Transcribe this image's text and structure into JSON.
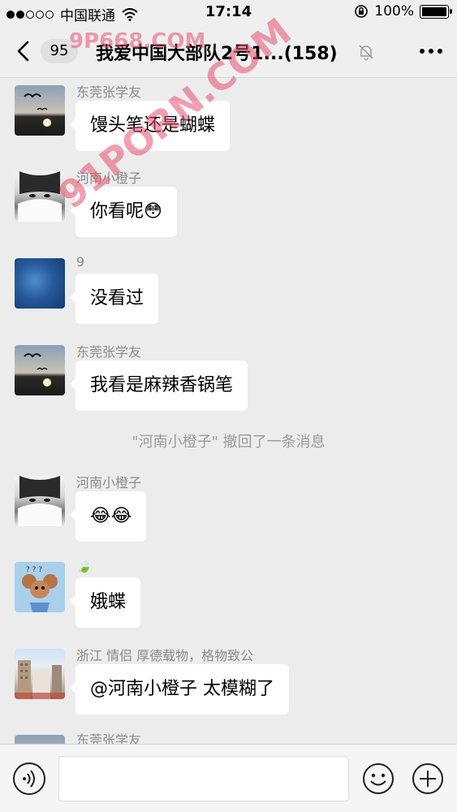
{
  "status_bar": {
    "carrier": "中国联通",
    "time": "17:14",
    "battery": "100%"
  },
  "header": {
    "unread_count": "95",
    "title": "我爱中国大部队2号1...(158)"
  },
  "messages": [
    {
      "sender": "东莞张学友",
      "text": "馒头笔还是蝴蝶",
      "avatar": "seagull-sunset"
    },
    {
      "sender": "河南小橙子",
      "text": "你看呢😳",
      "avatar": "girl-covered-face"
    },
    {
      "sender": "9",
      "text": "没看过",
      "avatar": "blue-water"
    },
    {
      "sender": "东莞张学友",
      "text": "我看是麻辣香锅笔",
      "avatar": "seagull-sunset"
    },
    {
      "sender": "河南小橙子",
      "text": "😂😂",
      "avatar": "girl-covered-face"
    },
    {
      "sender": "🍃",
      "text": "娥蝶",
      "avatar": "cartoon-mouse"
    },
    {
      "sender": "浙江  情侣  厚德载物，格物致公",
      "text": "@河南小橙子 太模糊了",
      "avatar": "city-building"
    },
    {
      "sender": "东莞张学友",
      "avatar": "seagull-sunset"
    }
  ],
  "system_notice": "\"河南小橙子\" 撤回了一条消息",
  "input_bar": {
    "voice_icon": "voice-icon",
    "emoji_icon": "emoji-icon",
    "plus_icon": "plus-icon"
  },
  "watermarks": [
    "9P668.COM",
    "91PORN.COM"
  ],
  "colors": {
    "background": "#ececec",
    "bubble": "#ffffff",
    "sender_text": "#8a8a8a"
  }
}
